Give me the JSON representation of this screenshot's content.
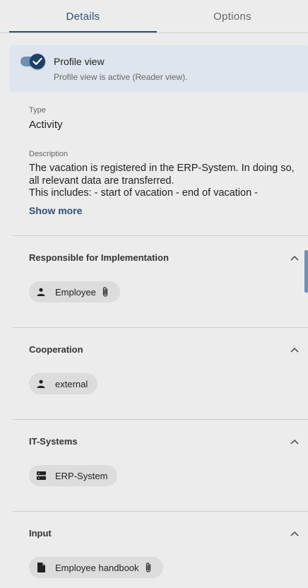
{
  "tabs": {
    "details": "Details",
    "options": "Options",
    "active": "Details"
  },
  "profile": {
    "enabled": true,
    "title": "Profile view",
    "subtitle": "Profile view is active (Reader view)."
  },
  "type": {
    "label": "Type",
    "value": "Activity"
  },
  "description": {
    "label": "Description",
    "text": "The vacation is registered in the ERP-System. In doing so, all relevant data are transferred.\nThis includes: - start of vacation - end of vacation - ",
    "show_more": "Show more"
  },
  "sections": [
    {
      "title": "Responsible for Implementation",
      "chip": {
        "label": "Employee",
        "icon": "person-icon",
        "attachment": true
      }
    },
    {
      "title": "Cooperation",
      "chip": {
        "label": "external",
        "icon": "person-icon",
        "attachment": false
      }
    },
    {
      "title": "IT-Systems",
      "chip": {
        "label": "ERP-System",
        "icon": "server-icon",
        "attachment": false
      }
    },
    {
      "title": "Input",
      "chip": {
        "label": "Employee handbook",
        "icon": "document-icon",
        "attachment": true
      }
    }
  ],
  "colors": {
    "accent": "#2f4f73",
    "toggle_track": "#6f8fb5",
    "card_bg": "#dfe5ee",
    "page_bg": "#ececec",
    "chip_bg": "#dcdcdc"
  }
}
